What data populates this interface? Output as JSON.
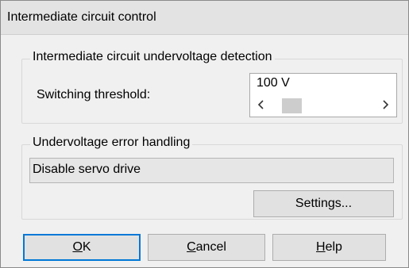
{
  "dialog": {
    "title": "Intermediate circuit control"
  },
  "undervoltage_group": {
    "label": "Intermediate circuit undervoltage detection",
    "threshold_label": "Switching threshold:",
    "threshold_value": "100 V",
    "scroll_left_icon": "chevron-left-icon",
    "scroll_right_icon": "chevron-right-icon"
  },
  "error_group": {
    "label": "Undervoltage error handling",
    "handling_value": "Disable servo drive",
    "settings_label": "Settings..."
  },
  "buttons": {
    "ok": {
      "mnemonic": "O",
      "rest": "K"
    },
    "cancel": {
      "mnemonic": "C",
      "rest": "ancel"
    },
    "help": {
      "mnemonic": "H",
      "rest": "elp"
    }
  },
  "colors": {
    "dialog_bg": "#f0f0f0",
    "default_button_border": "#0078d7"
  }
}
